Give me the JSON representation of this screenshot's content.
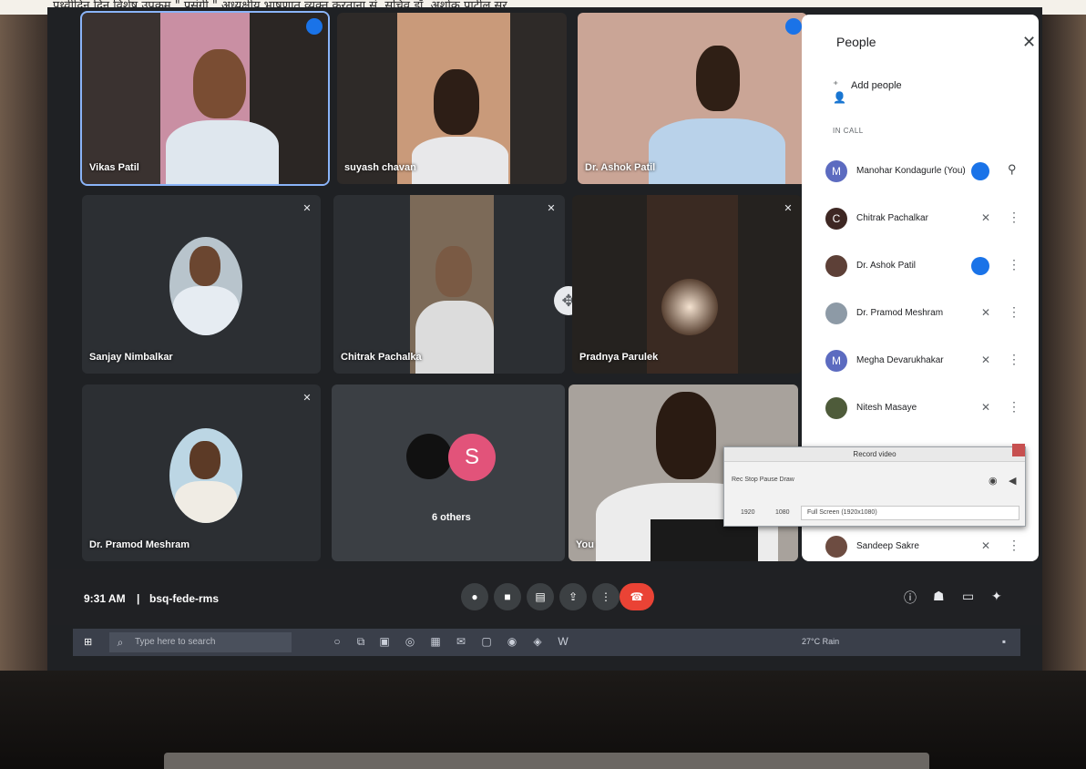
{
  "caption": "पृथ्वीदिन दिन विशेष उपक्रम \" प्रसंगी \" अध्यक्षीय भाषणात व्यक्त करताना सं. सचिव डॉ. अशोक पाटील सर",
  "tiles": [
    {
      "name": "Vikas Patil"
    },
    {
      "name": "suyash chavan"
    },
    {
      "name": "Dr. Ashok Patil"
    },
    {
      "name": "Sanjay Nimbalkar"
    },
    {
      "name": "Chitrak Pachalka"
    },
    {
      "name": "Pradnya Parulek"
    },
    {
      "name": "Dr. Pramod Meshram"
    },
    {
      "name": "6 others",
      "avatar_letter": "S"
    },
    {
      "name": "You"
    }
  ],
  "people_panel": {
    "title": "People",
    "add_label": "Add people",
    "section": "IN CALL",
    "participants": [
      {
        "name": "Manohar Kondagurle (You)",
        "initial": "M",
        "color": "#5c6bc0"
      },
      {
        "name": "Chitrak Pachalkar",
        "initial": "C",
        "color": "#3e2723"
      },
      {
        "name": "Dr. Ashok Patil",
        "initial": "",
        "color": "#5d4037"
      },
      {
        "name": "Dr. Pramod Meshram",
        "initial": "",
        "color": "#8d9aa6"
      },
      {
        "name": "Megha Devarukhakar",
        "initial": "M",
        "color": "#5c6bc0"
      },
      {
        "name": "Nitesh Masaye",
        "initial": "",
        "color": "#4e5b3a"
      },
      {
        "name": "Sandeep Sakre",
        "initial": "",
        "color": "#6d4c41"
      }
    ]
  },
  "record_dialog": {
    "title": "Record video",
    "row1": "Rec   Stop   Pause        Draw",
    "res1": "1920",
    "res2": "1080",
    "resolution": "Full Screen (1920x1080)"
  },
  "meeting": {
    "time": "9:31 AM",
    "code": "bsq-fede-rms",
    "separator": "|"
  },
  "taskbar": {
    "search_placeholder": "Type here to search",
    "tray_weather": "27°C  Rain"
  }
}
